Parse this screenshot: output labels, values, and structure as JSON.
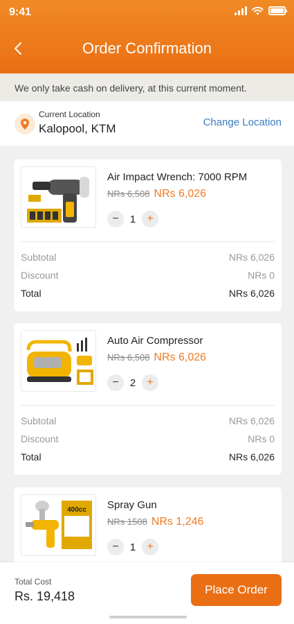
{
  "status_bar": {
    "time": "9:41"
  },
  "header": {
    "title": "Order Confirmation"
  },
  "notice": "We only take cash on delivery, at this current moment.",
  "location": {
    "label": "Current Location",
    "value": "Kalopool, KTM",
    "change_label": "Change Location"
  },
  "items": [
    {
      "name": "Air Impact Wrench: 7000 RPM",
      "old_price": "NRs 6,508",
      "price": "NRs 6,026",
      "quantity": "1",
      "image_badge": "1/2\"",
      "summary": {
        "subtotal_label": "Subtotal",
        "subtotal": "NRs 6,026",
        "discount_label": "Discount",
        "discount": "NRs 0",
        "total_label": "Total",
        "total": "NRs 6,026"
      }
    },
    {
      "name": "Auto Air Compressor",
      "old_price": "NRs 6,508",
      "price": "NRs 6,026",
      "quantity": "2",
      "summary": {
        "subtotal_label": "Subtotal",
        "subtotal": "NRs 6,026",
        "discount_label": "Discount",
        "discount": "NRs 0",
        "total_label": "Total",
        "total": "NRs 6,026"
      }
    },
    {
      "name": "Spray Gun",
      "old_price": "NRs 1508",
      "price": "NRs 1,246",
      "quantity": "1",
      "image_badge": "400cc"
    }
  ],
  "footer": {
    "total_label": "Total Cost",
    "total_value": "Rs. 19,418",
    "place_order_label": "Place Order"
  },
  "colors": {
    "accent": "#ea6f14",
    "link": "#3a7bc2",
    "notice_bg": "#ecebe6"
  }
}
